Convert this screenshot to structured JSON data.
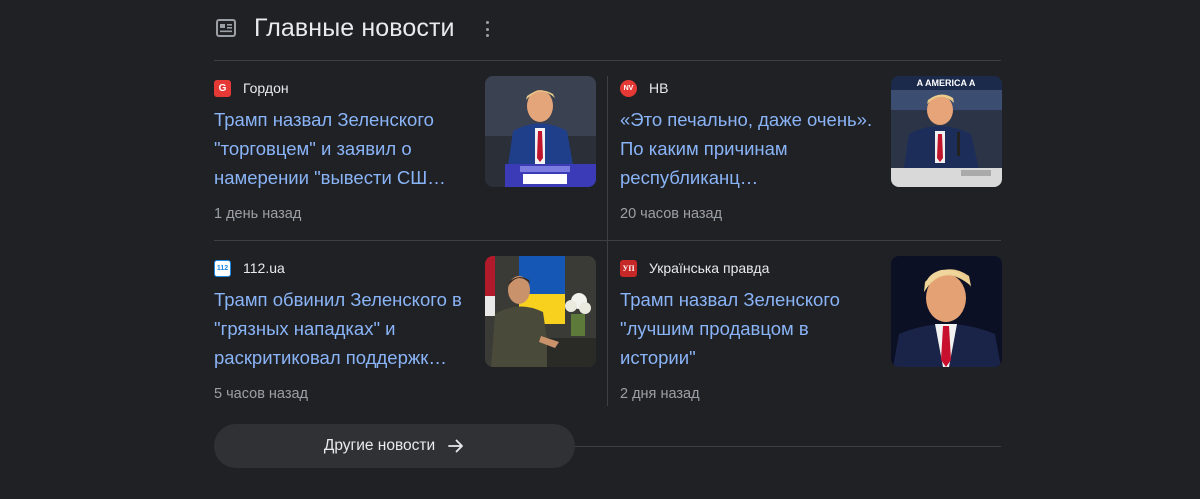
{
  "section": {
    "title": "Главные новости",
    "more_label": "Другие новости"
  },
  "articles": [
    {
      "source": "Гордон",
      "favicon_text": "G",
      "favicon_color": "#e53935",
      "headline": "Трамп назвал Зеленского \"торговцем\" и заявил о намерении \"вывести СШ…",
      "time": "1 день назад",
      "thumb_icon": "trump-rally-photo"
    },
    {
      "source": "НВ",
      "favicon_text": "NV",
      "favicon_color": "#e53935",
      "headline": "«Это печально, даже очень». По каким причинам республиканц…",
      "time": "20 часов назад",
      "thumb_icon": "trump-press-conference-photo",
      "thumb_banner": "A AMERICA A"
    },
    {
      "source": "112.ua",
      "favicon_text": "112",
      "favicon_color": "#1e88e5",
      "headline": "Трамп обвинил Зеленского в \"грязных нападках\" и раскритиковал поддержк…",
      "time": "5 часов назад",
      "thumb_icon": "zelensky-meeting-photo"
    },
    {
      "source": "Українська правда",
      "favicon_text": "УП",
      "favicon_color": "#c62828",
      "headline": "Трамп назвал Зеленского \"лучшим продавцом в истории\"",
      "time": "2 дня назад",
      "thumb_icon": "trump-portrait-photo"
    }
  ],
  "colors": {
    "background": "#202124",
    "link": "#8ab4f8",
    "muted": "#9aa0a6",
    "divider": "#3c4043",
    "button_bg": "#303134"
  }
}
